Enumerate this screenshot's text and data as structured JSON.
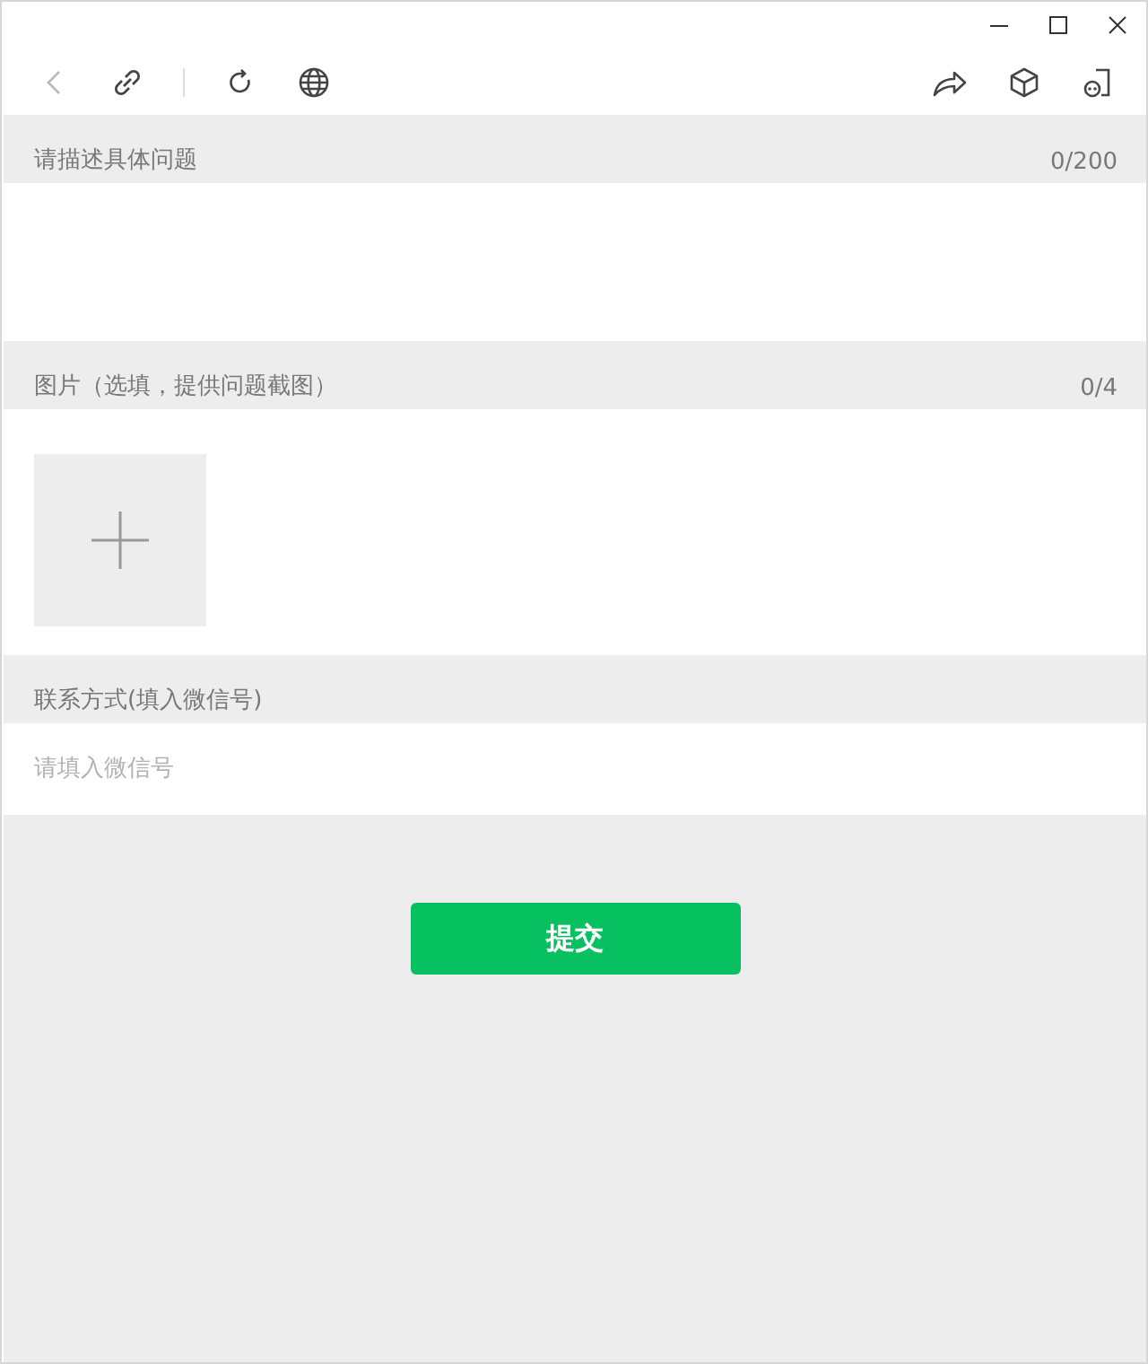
{
  "description": {
    "label": "请描述具体问题",
    "counter": "0/200"
  },
  "images": {
    "label": "图片（选填，提供问题截图）",
    "counter": "0/4"
  },
  "contact": {
    "label": "联系方式(填入微信号)",
    "placeholder": "请填入微信号"
  },
  "submit": "提交"
}
